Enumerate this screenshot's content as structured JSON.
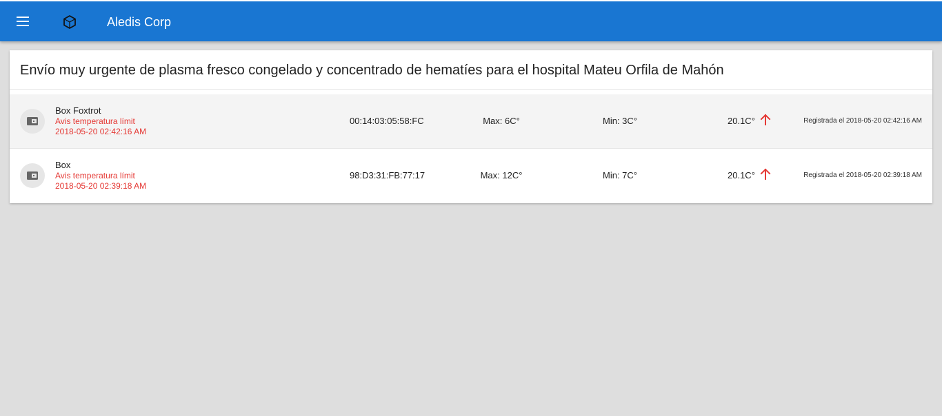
{
  "appbar": {
    "menu_icon": "menu-icon",
    "logo_icon": "cube-icon",
    "title": "Aledis Corp",
    "color": "#1976d2"
  },
  "shipment": {
    "title": "Envío muy urgente de plasma fresco congelado y concentrado de hematíes para el hospital Mateu Orfila de Mahón",
    "boxes": [
      {
        "name": "Box Foxtrot",
        "icon": "wallet-icon",
        "alert": "Avis temperatura límit",
        "alert_date": "2018-05-20 02:42:16 AM",
        "mac": "00:14:03:05:58:FC",
        "max": "Max: 6C°",
        "min": "Min: 3C°",
        "temperature": "20.1C°",
        "trend_icon": "arrow-up-icon",
        "registered": "Registrada el 2018-05-20 02:42:16 AM"
      },
      {
        "name": "Box",
        "icon": "wallet-icon",
        "alert": "Avis temperatura límit",
        "alert_date": "2018-05-20 02:39:18 AM",
        "mac": "98:D3:31:FB:77:17",
        "max": "Max: 12C°",
        "min": "Min: 7C°",
        "temperature": "20.1C°",
        "trend_icon": "arrow-up-icon",
        "registered": "Registrada el 2018-05-20 02:39:18 AM"
      }
    ],
    "alert_color": "#e53935"
  }
}
